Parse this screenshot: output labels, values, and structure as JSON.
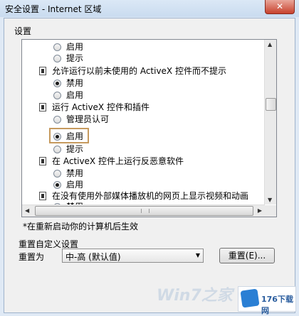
{
  "window": {
    "title": "安全设置 - Internet 区域",
    "close_glyph": "✕"
  },
  "group_label": "设置",
  "settings_list": [
    {
      "type": "radio",
      "label": "启用",
      "checked": false
    },
    {
      "type": "radio",
      "label": "提示",
      "checked": false
    },
    {
      "type": "header",
      "label": "允许运行以前未使用的 ActiveX 控件而不提示"
    },
    {
      "type": "radio",
      "label": "禁用",
      "checked": true
    },
    {
      "type": "radio",
      "label": "启用",
      "checked": false
    },
    {
      "type": "header",
      "label": "运行 ActiveX 控件和插件"
    },
    {
      "type": "radio",
      "label": "管理员认可",
      "checked": false
    },
    {
      "type": "radio",
      "label": "启用",
      "checked": true
    },
    {
      "type": "radio",
      "label": "提示",
      "checked": false
    },
    {
      "type": "header",
      "label": "在 ActiveX 控件上运行反恶意软件"
    },
    {
      "type": "radio",
      "label": "禁用",
      "checked": false
    },
    {
      "type": "radio",
      "label": "启用",
      "checked": true
    },
    {
      "type": "header",
      "label": "在没有使用外部媒体播放机的网页上显示视频和动画"
    },
    {
      "type": "radio",
      "label": "禁用",
      "checked": false
    }
  ],
  "note": "*在重新启动你的计算机后生效",
  "reset_section": {
    "label": "重置自定义设置",
    "reset_to_label": "重置为",
    "selected_level": "中-高 (默认值)",
    "reset_button": "重置(E)..."
  },
  "watermark": "Win7之家",
  "logo_text": "176下载网"
}
